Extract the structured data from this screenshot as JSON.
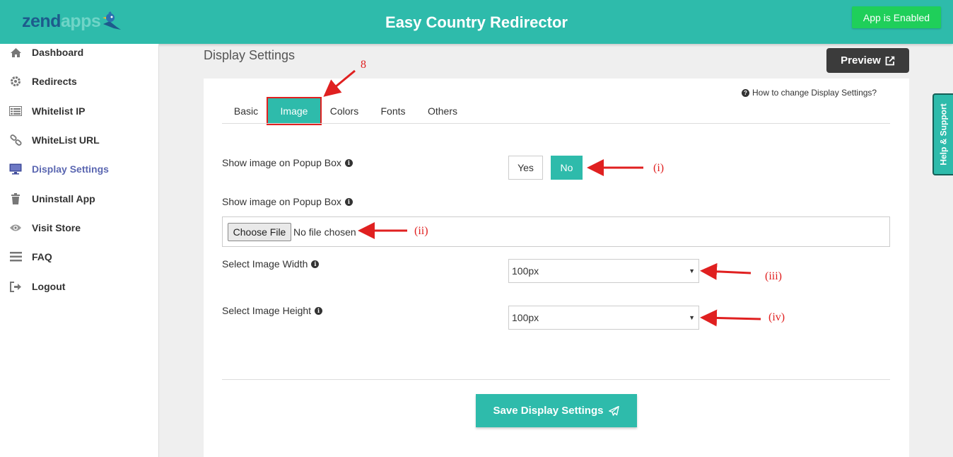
{
  "header": {
    "logo_part1": "zend",
    "logo_part2": "apps",
    "title": "Easy Country Redirector",
    "status_button": "App is Enabled"
  },
  "sidebar": {
    "items": [
      {
        "label": "Dashboard",
        "icon": "home-icon"
      },
      {
        "label": "Redirects",
        "icon": "gear-icon"
      },
      {
        "label": "Whitelist IP",
        "icon": "list-icon"
      },
      {
        "label": "WhiteList URL",
        "icon": "link-icon"
      },
      {
        "label": "Display Settings",
        "icon": "monitor-icon",
        "active": true
      },
      {
        "label": "Uninstall App",
        "icon": "trash-icon"
      },
      {
        "label": "Visit Store",
        "icon": "eye-icon"
      },
      {
        "label": "FAQ",
        "icon": "bars-icon"
      },
      {
        "label": "Logout",
        "icon": "logout-icon"
      }
    ]
  },
  "main": {
    "page_title": "Display Settings",
    "preview_label": "Preview",
    "howto_link": "How to change Display Settings?",
    "tabs": [
      {
        "label": "Basic"
      },
      {
        "label": "Image",
        "active": true
      },
      {
        "label": "Colors"
      },
      {
        "label": "Fonts"
      },
      {
        "label": "Others"
      }
    ],
    "fields": {
      "show_image_label": "Show image on Popup Box",
      "yes_label": "Yes",
      "no_label": "No",
      "selected": "No",
      "upload_label": "Show image on Popup Box",
      "choose_file_label": "Choose File",
      "no_file_text": "No file chosen",
      "width_label": "Select Image Width",
      "width_value": "100px",
      "height_label": "Select Image Height",
      "height_value": "100px"
    },
    "save_label": "Save Display Settings"
  },
  "help_tab": "Help & Support",
  "annotations": {
    "step": "8",
    "i": "(i)",
    "ii": "(ii)",
    "iii": "(iii)",
    "iv": "(iv)"
  },
  "colors": {
    "primary": "#2ebbab",
    "enabled_green": "#1fcf5a",
    "annotation_red": "#e02020",
    "active_nav": "#5b67b1"
  }
}
